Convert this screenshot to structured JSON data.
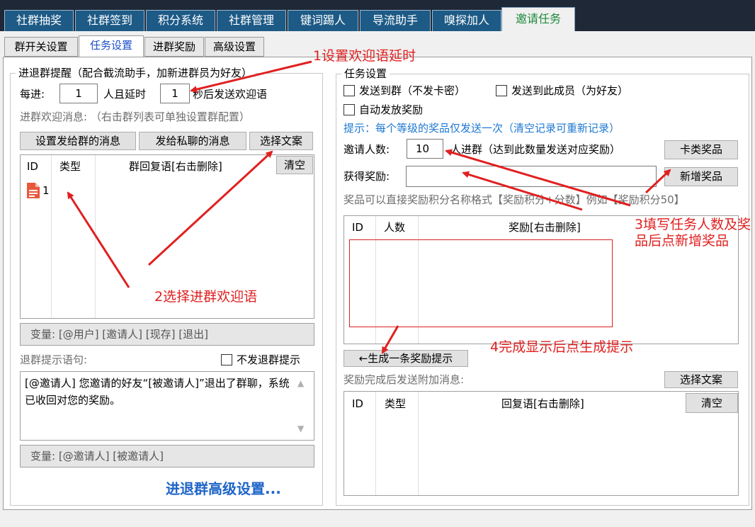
{
  "top_tabs": [
    {
      "label": "社群抽奖"
    },
    {
      "label": "社群签到"
    },
    {
      "label": "积分系统"
    },
    {
      "label": "社群管理"
    },
    {
      "label": "键词踢人"
    },
    {
      "label": "导流助手"
    },
    {
      "label": "嗅探加人"
    },
    {
      "label": "邀请任务"
    }
  ],
  "sub_tabs": [
    {
      "label": "群开关设置"
    },
    {
      "label": "任务设置"
    },
    {
      "label": "进群奖励"
    },
    {
      "label": "高级设置"
    }
  ],
  "left": {
    "group_title": "进退群提醒（配合截流助手，加新进群员为好友）",
    "every_label": "每进:",
    "every_value": "1",
    "delay_label": "人且延时",
    "delay_value": "1",
    "delay_suffix": "秒后发送欢迎语",
    "welcome_hint": "进群欢迎消息:  （右击群列表可单独设置群配置）",
    "btn_group_msg": "设置发给群的消息",
    "btn_private_msg": "发给私聊的消息",
    "btn_select_text": "选择文案",
    "col_id": "ID",
    "col_type": "类型",
    "col_reply": "群回复语[右击删除]",
    "btn_clear": "清空",
    "row_id": "1",
    "vars": "变量: [@用户] [邀请人] [现存] [退出]",
    "leave_label": "退群提示语句:",
    "no_leave_label": "不发退群提示",
    "leave_text": "[@邀请人] 您邀请的好友“[被邀请人]”退出了群聊，系统已收回对您的奖励。",
    "vars2": "变量: [@邀请人] [被邀请人]",
    "advanced_link": "进退群高级设置..."
  },
  "right": {
    "group_title": "任务设置",
    "chk_send_group": "发送到群（不发卡密）",
    "chk_send_member": "发送到此成员（为好友）",
    "chk_auto": "自动发放奖励",
    "tip": "提示：每个等级的奖品仅发送一次（清空记录可重新记录）",
    "invite_label": "邀请人数:",
    "invite_value": "10",
    "invite_suffix": "人进群（达到此数量发送对应奖励）",
    "btn_card": "卡类奖品",
    "reward_label": "获得奖励:",
    "reward_value": "",
    "btn_add": "新增奖品",
    "format_hint": "奖品可以直接奖励积分名称格式【奖励积分+分数】例如【奖励积分50】",
    "col_id": "ID",
    "col_count": "人数",
    "col_reward": "奖励[右击删除]",
    "btn_generate": "←生成一条奖励提示",
    "extra_label": "奖励完成后发送附加消息:",
    "btn_select_text": "选择文案",
    "col_id2": "ID",
    "col_type": "类型",
    "col_reply": "回复语[右击删除]",
    "btn_clear": "清空"
  },
  "annotations": {
    "a1": "1设置欢迎语延时",
    "a2": "2选择进群欢迎语",
    "a3": "3填写任务人数及奖品后点新增奖品",
    "a4": "4完成显示后点生成提示"
  },
  "colors": {
    "annotation": "#e02020",
    "tab_bg": "#1d5a86",
    "active_tab_text": "#1d8a3c",
    "link": "#1e64c8",
    "tip": "#1e78d2"
  }
}
